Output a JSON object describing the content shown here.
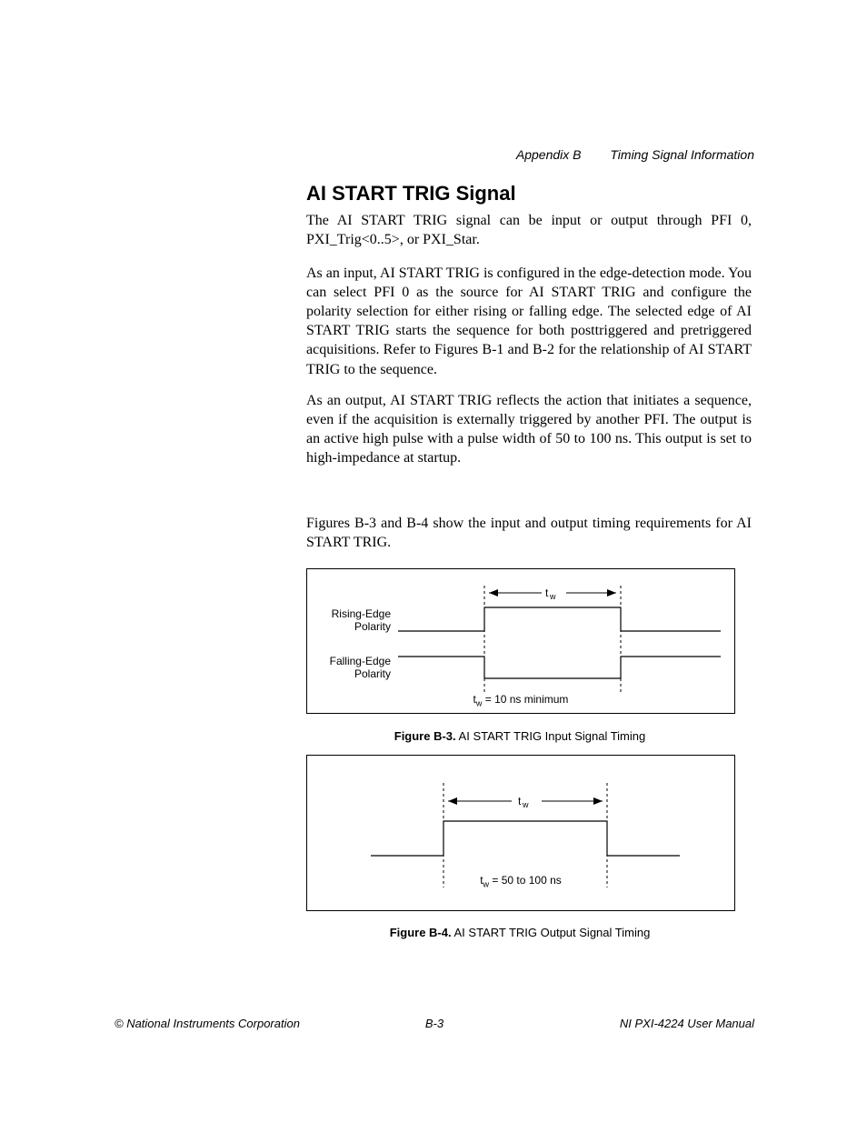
{
  "header": {
    "appendix": "Appendix B",
    "title": "Timing Signal Information"
  },
  "section": {
    "heading": "AI START TRIG Signal",
    "para1": "The AI START TRIG signal can be input or output through PFI 0, PXI_Trig<0..5>, or PXI_Star.",
    "para2": "As an input, AI START TRIG is configured in the edge-detection mode. You can select PFI 0 as the source for AI START TRIG and configure the polarity selection for either rising or falling edge. The selected edge of AI START TRIG starts the sequence for both posttriggered and pretriggered acquisitions. Refer to Figures B-1 and B-2 for the relationship of AI START TRIG to the sequence.",
    "para3": "As an output, AI START TRIG reflects the action that initiates a sequence, even if the acquisition is externally triggered by another PFI. The output is an active high pulse with a pulse width of 50 to 100 ns. This output is set to high-impedance at startup.",
    "para4": "Figures B-3 and B-4 show the input and output timing requirements for AI START TRIG."
  },
  "figure1": {
    "label1a": "Rising-Edge",
    "label1b": "Polarity",
    "label2a": "Falling-Edge",
    "label2b": "Polarity",
    "tw_label": "t",
    "tw_sub": "w",
    "note_prefix": "t",
    "note_sub": "w",
    "note_rest": " = 10 ns minimum",
    "caption_bold": "Figure B-3.",
    "caption_rest": "  AI START TRIG Input Signal Timing"
  },
  "figure2": {
    "tw_label": "t",
    "tw_sub": "w",
    "note_prefix": "t",
    "note_sub": "w",
    "note_rest": " = 50 to 100 ns",
    "caption_bold": "Figure B-4.",
    "caption_rest": "  AI START TRIG Output Signal Timing"
  },
  "footer": {
    "left": "© National Instruments Corporation",
    "center": "B-3",
    "right": "NI PXI-4224 User Manual"
  }
}
